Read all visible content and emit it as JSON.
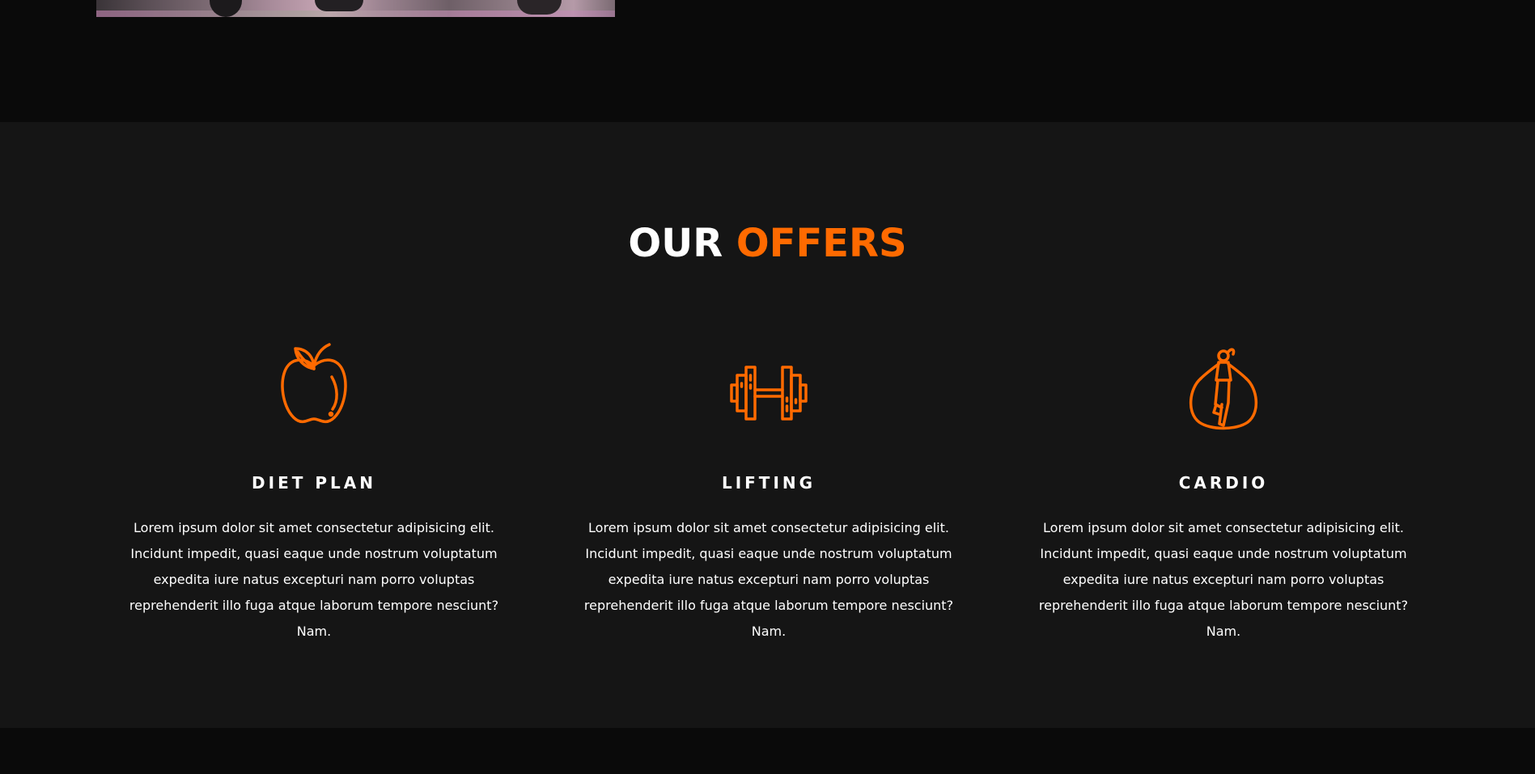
{
  "colors": {
    "accent": "#ff6a00",
    "page_background": "#0a0a0a",
    "section_background": "#151515",
    "text": "#ffffff"
  },
  "offers": {
    "title_main": "OUR",
    "title_accent": "OFFERS",
    "cards": [
      {
        "icon": "apple-icon",
        "title": "DIET PLAN",
        "text": "Lorem ipsum dolor sit amet consectetur adipisicing elit. Incidunt impedit, quasi eaque unde nostrum voluptatum expedita iure natus excepturi nam porro voluptas reprehenderit illo fuga atque laborum tempore nesciunt? Nam."
      },
      {
        "icon": "dumbbell-icon",
        "title": "LIFTING",
        "text": "Lorem ipsum dolor sit amet consectetur adipisicing elit. Incidunt impedit, quasi eaque unde nostrum voluptatum expedita iure natus excepturi nam porro voluptas reprehenderit illo fuga atque laborum tempore nesciunt? Nam."
      },
      {
        "icon": "jump-rope-icon",
        "title": "CARDIO",
        "text": "Lorem ipsum dolor sit amet consectetur adipisicing elit. Incidunt impedit, quasi eaque unde nostrum voluptatum expedita iure natus excepturi nam porro voluptas reprehenderit illo fuga atque laborum tempore nesciunt? Nam."
      }
    ]
  }
}
